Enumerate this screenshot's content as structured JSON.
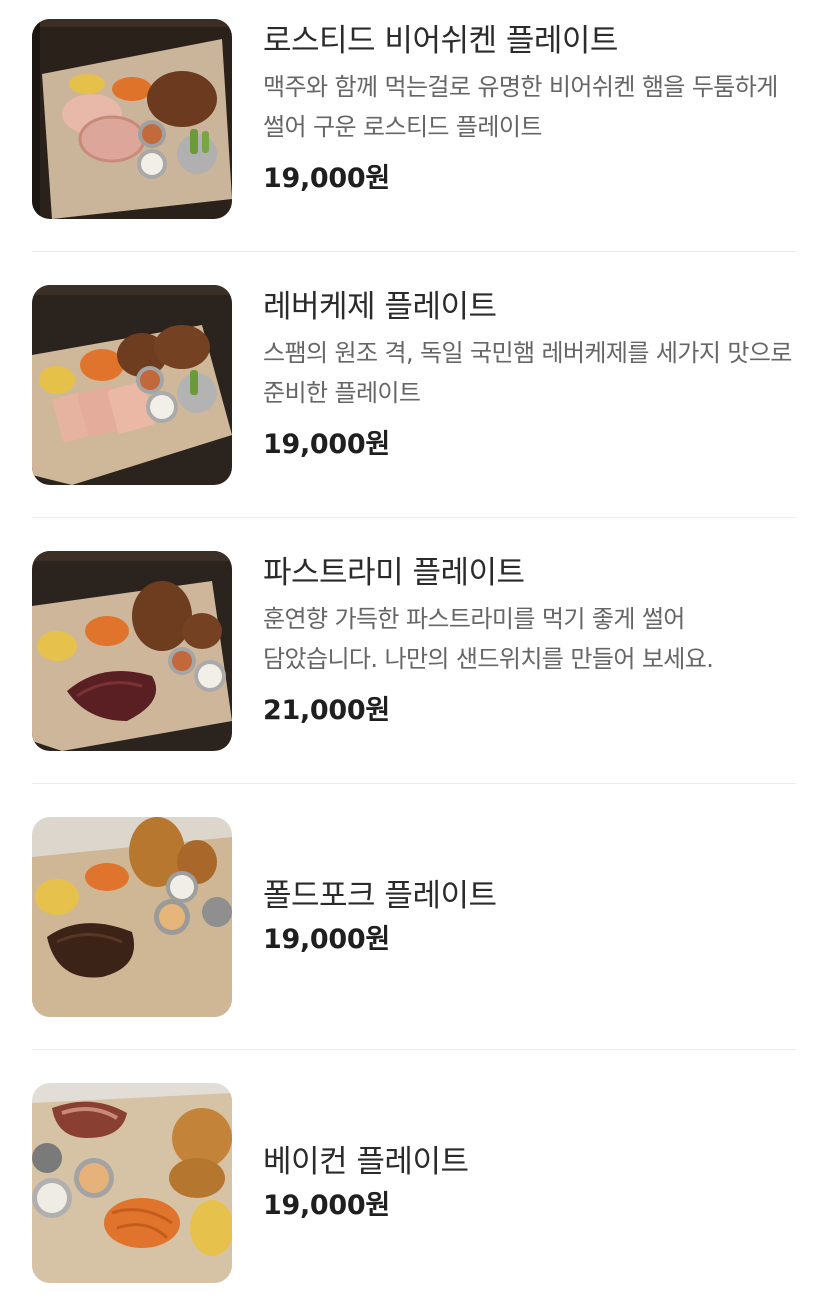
{
  "menu": {
    "items": [
      {
        "name": "로스티드 비어쉬켄 플레이트",
        "description": "맥주와 함께 먹는걸로 유명한 비어쉬켄 햄을 두툼하게 썰어 구운 로스티드 플레이트",
        "price": "19,000원",
        "image_icon": "food-plate-icon"
      },
      {
        "name": "레버케제 플레이트",
        "description": "스팸의 원조 격, 독일 국민햄 레버케제를 세가지 맛으로 준비한 플레이트",
        "price": "19,000원",
        "image_icon": "food-plate-icon"
      },
      {
        "name": "파스트라미 플레이트",
        "description": "훈연향 가득한 파스트라미를 먹기 좋게 썰어 담았습니다. 나만의 샌드위치를 만들어 보세요.",
        "price": "21,000원",
        "image_icon": "food-plate-icon"
      },
      {
        "name": "폴드포크 플레이트",
        "price": "19,000원",
        "image_icon": "food-plate-icon"
      },
      {
        "name": "베이컨 플레이트",
        "price": "19,000원",
        "image_icon": "food-plate-icon"
      }
    ]
  },
  "colors": {
    "background": "#ffffff",
    "divider": "#ececec",
    "name_text": "#2b2b2b",
    "description_text": "#666666",
    "price_text": "#1f1f1f"
  }
}
